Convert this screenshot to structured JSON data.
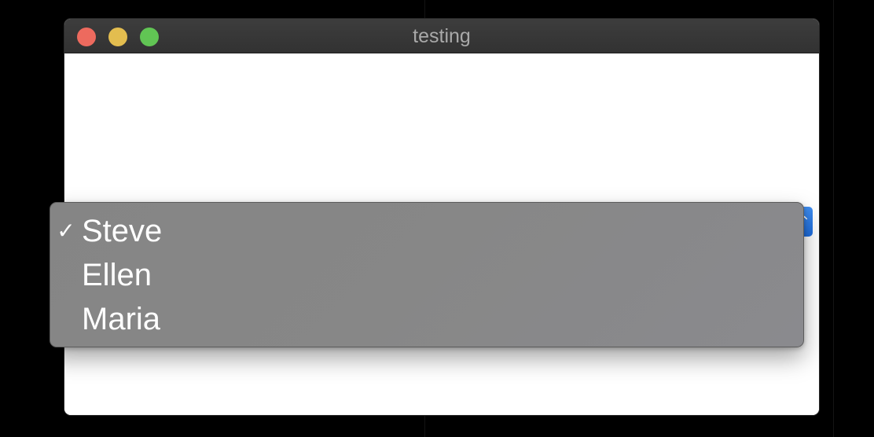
{
  "window": {
    "title": "testing"
  },
  "popup_button": {
    "arrows_icon": "up-down-chevron-icon",
    "glyph": "⌃"
  },
  "menu": {
    "check_glyph": "✓",
    "items": [
      {
        "label": "Steve",
        "checked": true
      },
      {
        "label": "Ellen",
        "checked": false
      },
      {
        "label": "Maria",
        "checked": false
      }
    ]
  },
  "colors": {
    "close": "#ed6a5e",
    "minimize": "#e3bd4f",
    "zoom": "#61c554",
    "accent": "#2f7ceb"
  }
}
